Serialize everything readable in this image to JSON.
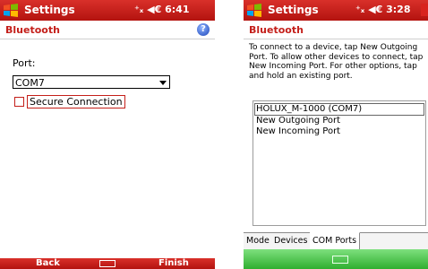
{
  "left": {
    "title": "Settings",
    "status": "⁺ₓ ◀€ 6:41",
    "header": "Bluetooth",
    "help_glyph": "?",
    "port_label": "Port:",
    "port_value": "COM7",
    "secure_label": "Secure Connection",
    "softkey_left": "Back",
    "softkey_right": "Finish"
  },
  "right": {
    "title": "Settings",
    "status": "⁺ₓ ◀€ 3:28",
    "header": "Bluetooth",
    "instructions": "To connect to a device, tap New Outgoing Port. To allow other devices to connect, tap New Incoming Port. For other options, tap and hold an existing port.",
    "ports": [
      "HOLUX_M-1000 (COM7)",
      "New Outgoing Port",
      "New Incoming Port"
    ],
    "tabs": [
      "Mode",
      "Devices",
      "COM Ports"
    ],
    "active_tab": "COM Ports"
  },
  "colors": {
    "titlebar": "#c41f1a",
    "header_text": "#c41f1a",
    "softbar_green": "#3cb83c"
  },
  "icons": [
    "windows-logo-icon",
    "connectivity-icon",
    "volume-icon",
    "help-icon",
    "keyboard-icon"
  ]
}
